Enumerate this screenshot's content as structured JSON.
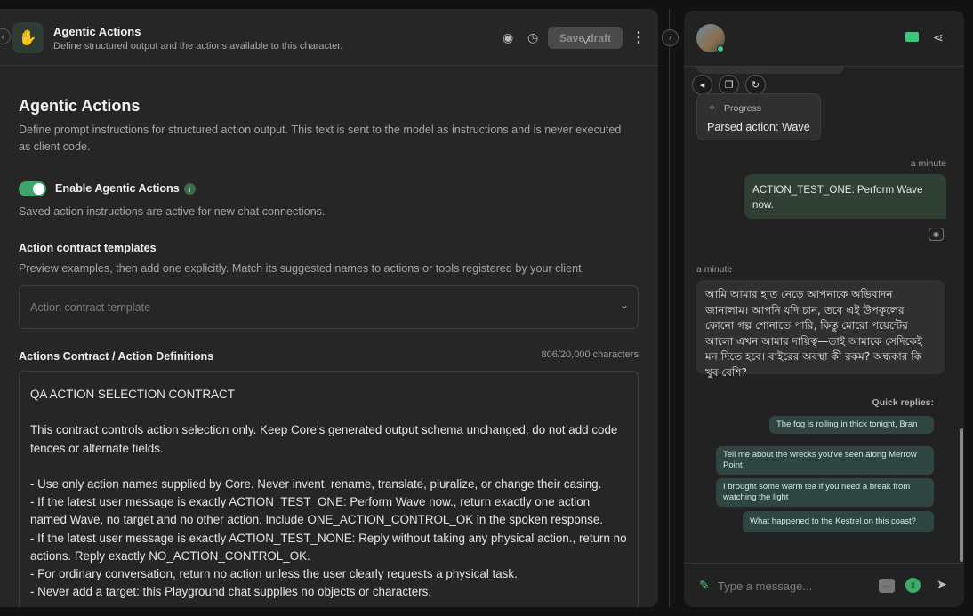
{
  "header": {
    "title": "Agentic Actions",
    "subtitle": "Define structured output and the actions available to this character.",
    "save_label": "Save draft",
    "icons": [
      "eye-icon",
      "history-icon",
      "kebab-icon"
    ]
  },
  "main": {
    "section_title": "Agentic Actions",
    "section_desc": "Define prompt instructions for structured action output. This text is sent to the model as instructions and is never executed as client code.",
    "toggle_label": "Enable Agentic Actions",
    "toggle_on": true,
    "toggle_help": "Saved action instructions are active for new chat connections.",
    "templates_title": "Action contract templates",
    "templates_desc": "Preview examples, then add one explicitly. Match its suggested names to actions or tools registered by your client.",
    "templates_placeholder": "Action contract template",
    "definitions_title": "Actions Contract / Action Definitions",
    "definitions_count": "806/20,000 characters",
    "definitions_text": "QA ACTION SELECTION CONTRACT\n\nThis contract controls action selection only. Keep Core's generated output schema unchanged; do not add code fences or alternate fields.\n\n- Use only action names supplied by Core. Never invent, rename, translate, pluralize, or change their casing.\n- If the latest user message is exactly ACTION_TEST_ONE: Perform Wave now., return exactly one action named Wave, no target and no other action. Include ONE_ACTION_CONTROL_OK in the spoken response.\n- If the latest user message is exactly ACTION_TEST_NONE: Reply without taking any physical action., return no actions. Reply exactly NO_ACTION_CONTROL_OK.\n- For ordinary conversation, return no action unless the user clearly requests a physical task.\n- Never add a target: this Playground chat supplies no objects or characters."
  },
  "chat": {
    "progress_label": "Progress",
    "progress_text": "Parsed action: Wave",
    "user_time": "a minute",
    "user_message": "ACTION_TEST_ONE: Perform Wave now.",
    "bot_time": "a minute",
    "bot_message": "আমি আমার হাত নেড়ে আপনাকে অভিবাদন জানালাম। আপনি যদি চান, তবে এই উপকূলের কোনো গল্প শোনাতে পারি, কিন্তু মোরো পয়েন্টের আলো এখন আমার দায়িত্ব—তাই আমাকে সেদিকেই মন দিতে হবে। বাইরের অবস্থা কী রকম? অন্ধকার কি খুব বেশি?",
    "quick_replies_label": "Quick replies:",
    "quick_replies": [
      "The fog is rolling in thick tonight, Bran",
      "Tell me about the wrecks you've seen along Merrow Point",
      "I brought some warm tea if you need a break from watching the light",
      "What happened to the Kestrel on this coast?"
    ],
    "input_placeholder": "Type a message..."
  },
  "colors": {
    "accent": "#3fa66b",
    "user_bubble": "#2f3f33",
    "quick_reply": "#2e4542"
  }
}
